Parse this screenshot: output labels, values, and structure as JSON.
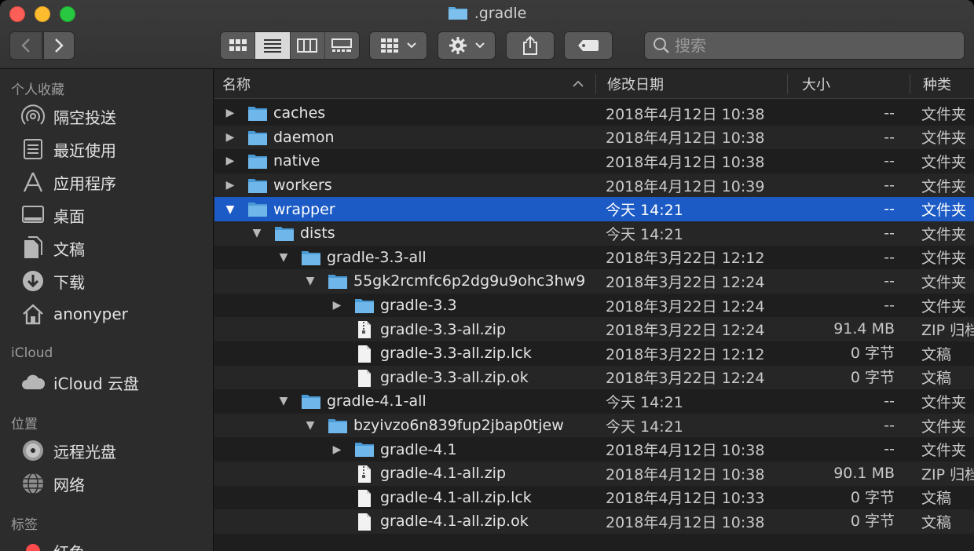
{
  "window": {
    "title": ".gradle"
  },
  "toolbar": {
    "search_placeholder": "搜索"
  },
  "sidebar": {
    "sections": [
      {
        "heading": "个人收藏",
        "items": [
          {
            "label": "隔空投送",
            "icon": "airdrop-icon"
          },
          {
            "label": "最近使用",
            "icon": "recents-icon"
          },
          {
            "label": "应用程序",
            "icon": "applications-icon"
          },
          {
            "label": "桌面",
            "icon": "desktop-icon"
          },
          {
            "label": "文稿",
            "icon": "documents-icon"
          },
          {
            "label": "下载",
            "icon": "downloads-icon"
          },
          {
            "label": "anonyper",
            "icon": "home-icon"
          }
        ]
      },
      {
        "heading": "iCloud",
        "items": [
          {
            "label": "iCloud 云盘",
            "icon": "cloud-icon"
          }
        ]
      },
      {
        "heading": "位置",
        "items": [
          {
            "label": "远程光盘",
            "icon": "disc-icon"
          },
          {
            "label": "网络",
            "icon": "network-icon"
          }
        ]
      },
      {
        "heading": "标签",
        "items": [
          {
            "label": "红色",
            "icon": "tag-red-icon",
            "color": "#ff4b4b"
          }
        ]
      }
    ]
  },
  "columns": {
    "name": "名称",
    "date": "修改日期",
    "size": "大小",
    "kind": "种类"
  },
  "files": [
    {
      "name": "caches",
      "date": "2018年4月12日 10:38",
      "size": "--",
      "kind": "文件夹",
      "type": "folder",
      "depth": 0,
      "disclosure": "collapsed"
    },
    {
      "name": "daemon",
      "date": "2018年4月12日 10:38",
      "size": "--",
      "kind": "文件夹",
      "type": "folder",
      "depth": 0,
      "disclosure": "collapsed"
    },
    {
      "name": "native",
      "date": "2018年4月12日 10:38",
      "size": "--",
      "kind": "文件夹",
      "type": "folder",
      "depth": 0,
      "disclosure": "collapsed"
    },
    {
      "name": "workers",
      "date": "2018年4月12日 10:39",
      "size": "--",
      "kind": "文件夹",
      "type": "folder",
      "depth": 0,
      "disclosure": "collapsed"
    },
    {
      "name": "wrapper",
      "date": "今天 14:21",
      "size": "--",
      "kind": "文件夹",
      "type": "folder",
      "depth": 0,
      "disclosure": "expanded",
      "selected": true
    },
    {
      "name": "dists",
      "date": "今天 14:21",
      "size": "--",
      "kind": "文件夹",
      "type": "folder",
      "depth": 1,
      "disclosure": "expanded"
    },
    {
      "name": "gradle-3.3-all",
      "date": "2018年3月22日 12:12",
      "size": "--",
      "kind": "文件夹",
      "type": "folder",
      "depth": 2,
      "disclosure": "expanded"
    },
    {
      "name": "55gk2rcmfc6p2dg9u9ohc3hw9",
      "date": "2018年3月22日 12:24",
      "size": "--",
      "kind": "文件夹",
      "type": "folder",
      "depth": 3,
      "disclosure": "expanded"
    },
    {
      "name": "gradle-3.3",
      "date": "2018年3月22日 12:24",
      "size": "--",
      "kind": "文件夹",
      "type": "folder",
      "depth": 4,
      "disclosure": "collapsed"
    },
    {
      "name": "gradle-3.3-all.zip",
      "date": "2018年3月22日 12:24",
      "size": "91.4 MB",
      "kind": "ZIP 归档",
      "type": "zip",
      "depth": 4,
      "disclosure": "none"
    },
    {
      "name": "gradle-3.3-all.zip.lck",
      "date": "2018年3月22日 12:12",
      "size": "0 字节",
      "kind": "文稿",
      "type": "doc",
      "depth": 4,
      "disclosure": "none"
    },
    {
      "name": "gradle-3.3-all.zip.ok",
      "date": "2018年3月22日 12:24",
      "size": "0 字节",
      "kind": "文稿",
      "type": "doc",
      "depth": 4,
      "disclosure": "none"
    },
    {
      "name": "gradle-4.1-all",
      "date": "今天 14:21",
      "size": "--",
      "kind": "文件夹",
      "type": "folder",
      "depth": 2,
      "disclosure": "expanded"
    },
    {
      "name": "bzyivzo6n839fup2jbap0tjew",
      "date": "今天 14:21",
      "size": "--",
      "kind": "文件夹",
      "type": "folder",
      "depth": 3,
      "disclosure": "expanded"
    },
    {
      "name": "gradle-4.1",
      "date": "2018年4月12日 10:38",
      "size": "--",
      "kind": "文件夹",
      "type": "folder",
      "depth": 4,
      "disclosure": "collapsed"
    },
    {
      "name": "gradle-4.1-all.zip",
      "date": "2018年4月12日 10:38",
      "size": "90.1 MB",
      "kind": "ZIP 归档",
      "type": "zip",
      "depth": 4,
      "disclosure": "none"
    },
    {
      "name": "gradle-4.1-all.zip.lck",
      "date": "2018年4月12日 10:33",
      "size": "0 字节",
      "kind": "文稿",
      "type": "doc",
      "depth": 4,
      "disclosure": "none"
    },
    {
      "name": "gradle-4.1-all.zip.ok",
      "date": "2018年4月12日 10:38",
      "size": "0 字节",
      "kind": "文稿",
      "type": "doc",
      "depth": 4,
      "disclosure": "none"
    }
  ],
  "colors": {
    "selection": "#1c5bc6",
    "folder": "#5aa8e0"
  }
}
